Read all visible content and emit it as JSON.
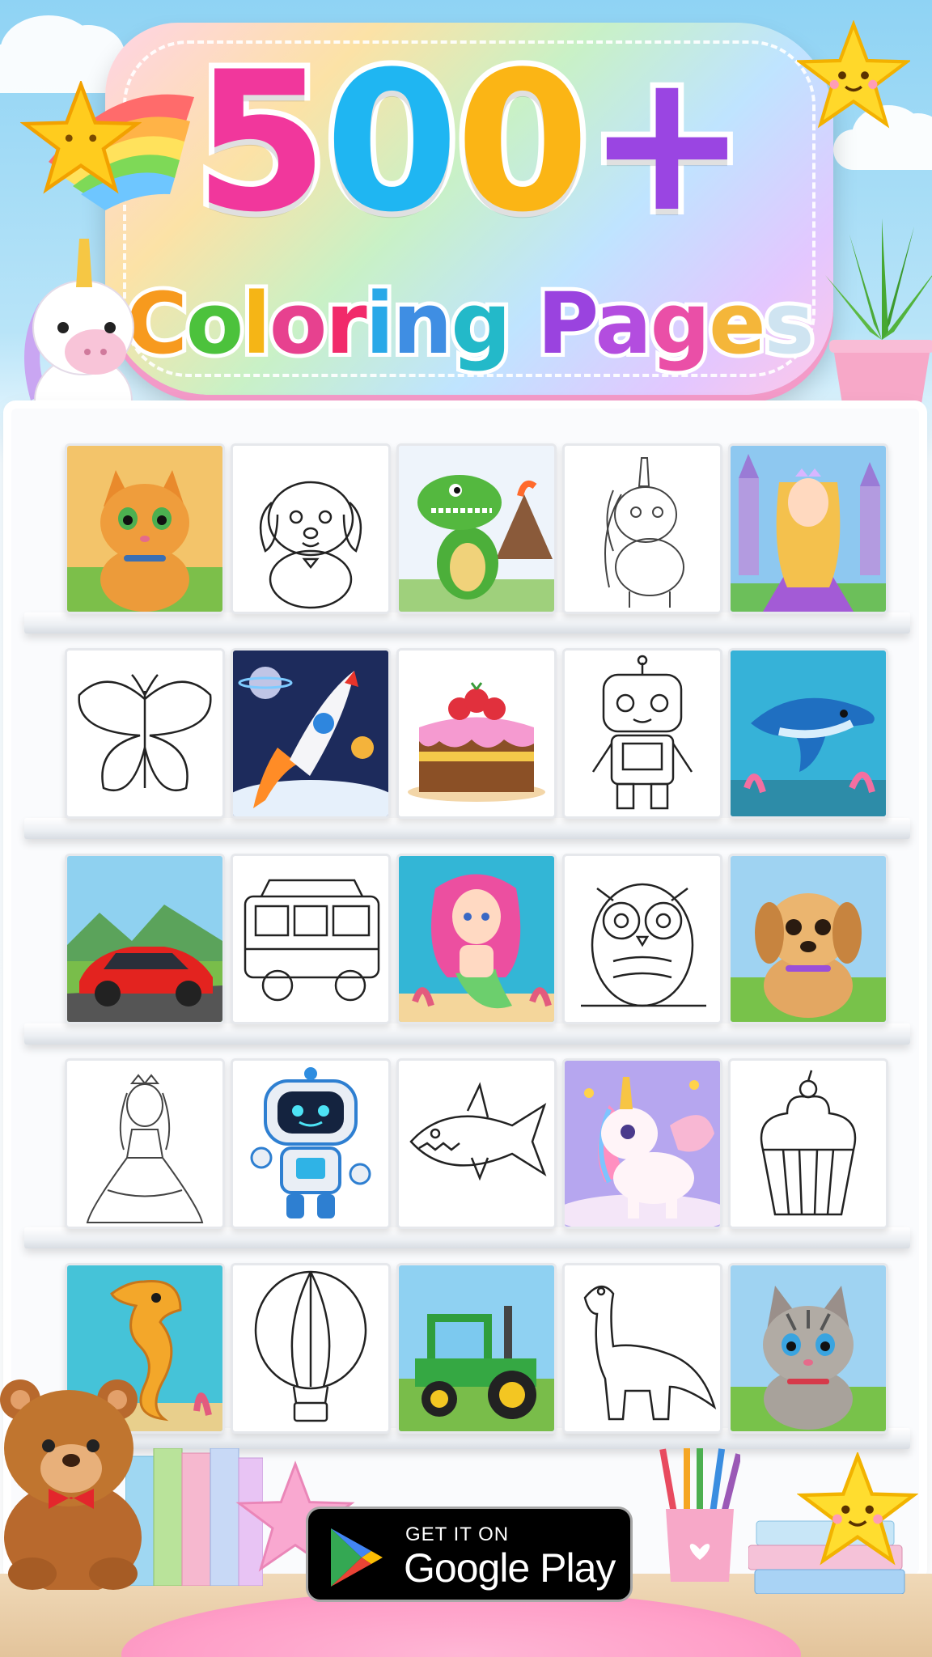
{
  "header": {
    "big_number": [
      "5",
      "0",
      "0",
      "+"
    ],
    "big_number_colors": [
      "#f1379c",
      "#1fb6f2",
      "#fbb515",
      "#9a45e2"
    ],
    "subtitle": [
      "C",
      "o",
      "l",
      "o",
      "r",
      "i",
      "n",
      "g",
      " ",
      "P",
      "a",
      "g",
      "e",
      "s"
    ],
    "subtitle_colors": [
      "#f79a1e",
      "#4cc23c",
      "#f5b516",
      "#e7418f",
      "#f12a6a",
      "#29a8e8",
      "#3f8ee3",
      "#23b9c9",
      "#fff",
      "#9a43df",
      "#b34ddf",
      "#ea4fa7",
      "#f4b63a",
      "#cfe4f1"
    ]
  },
  "gallery": {
    "items": [
      {
        "name": "cat-colored"
      },
      {
        "name": "puppy-outline"
      },
      {
        "name": "dinosaur-colored"
      },
      {
        "name": "unicorn-outline"
      },
      {
        "name": "princess-colored"
      },
      {
        "name": "butterfly-outline"
      },
      {
        "name": "rocket-colored"
      },
      {
        "name": "cake-colored"
      },
      {
        "name": "robot-outline"
      },
      {
        "name": "dolphin-colored"
      },
      {
        "name": "car-colored"
      },
      {
        "name": "bus-outline"
      },
      {
        "name": "mermaid-colored"
      },
      {
        "name": "owl-outline"
      },
      {
        "name": "dog-colored"
      },
      {
        "name": "princess-outline"
      },
      {
        "name": "robot-colored"
      },
      {
        "name": "shark-outline"
      },
      {
        "name": "unicorn-colored"
      },
      {
        "name": "cupcake-outline"
      },
      {
        "name": "seahorse-colored"
      },
      {
        "name": "balloon-outline"
      },
      {
        "name": "tractor-colored"
      },
      {
        "name": "dinosaur-outline"
      },
      {
        "name": "kitten-colored"
      }
    ]
  },
  "store_button": {
    "small_label": "GET IT ON",
    "big_label": "Google Play"
  },
  "icons": [
    "google-play-icon",
    "star-icon",
    "rainbow-icon",
    "unicorn-icon",
    "plant-icon",
    "teddy-bear-icon",
    "pencil-cup-icon",
    "books-icon"
  ]
}
